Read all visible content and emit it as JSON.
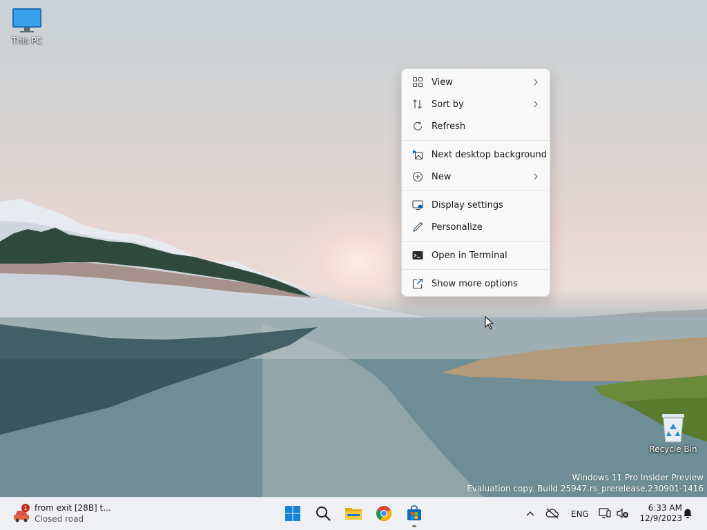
{
  "desktop": {
    "icons": [
      {
        "label": "This PC",
        "icon": "monitor-icon"
      },
      {
        "label": "Recycle Bin",
        "icon": "recycle-bin-icon"
      }
    ],
    "watermark": {
      "line1": "Windows 11 Pro Insider Preview",
      "line2": "Evaluation copy. Build 25947.rs_prerelease.230901-1416"
    }
  },
  "context_menu": {
    "items": [
      {
        "label": "View",
        "icon": "grid-view-icon",
        "submenu": true
      },
      {
        "label": "Sort by",
        "icon": "sort-icon",
        "submenu": true
      },
      {
        "label": "Refresh",
        "icon": "refresh-icon",
        "submenu": false
      },
      {
        "label": "Next desktop background",
        "icon": "next-background-icon",
        "submenu": false
      },
      {
        "label": "New",
        "icon": "plus-circle-icon",
        "submenu": true
      },
      {
        "label": "Display settings",
        "icon": "display-settings-icon",
        "submenu": false
      },
      {
        "label": "Personalize",
        "icon": "pen-icon",
        "submenu": false
      },
      {
        "label": "Open in Terminal",
        "icon": "terminal-icon",
        "submenu": false
      },
      {
        "label": "Show more options",
        "icon": "external-icon",
        "submenu": false
      }
    ]
  },
  "taskbar": {
    "widget": {
      "title": "from exit [28B] t...",
      "subtitle": "Closed road",
      "badge": "1"
    },
    "apps": [
      "start-icon",
      "search-icon",
      "file-explorer-icon",
      "chrome-icon",
      "store-icon"
    ],
    "tray": {
      "language": "ENG",
      "time": "6:33 AM",
      "date": "12/9/2023"
    }
  },
  "colors": {
    "accent": "#0067c0",
    "menu_bg": "#f9f9f9",
    "taskbar_bg": "#eef0f3"
  }
}
